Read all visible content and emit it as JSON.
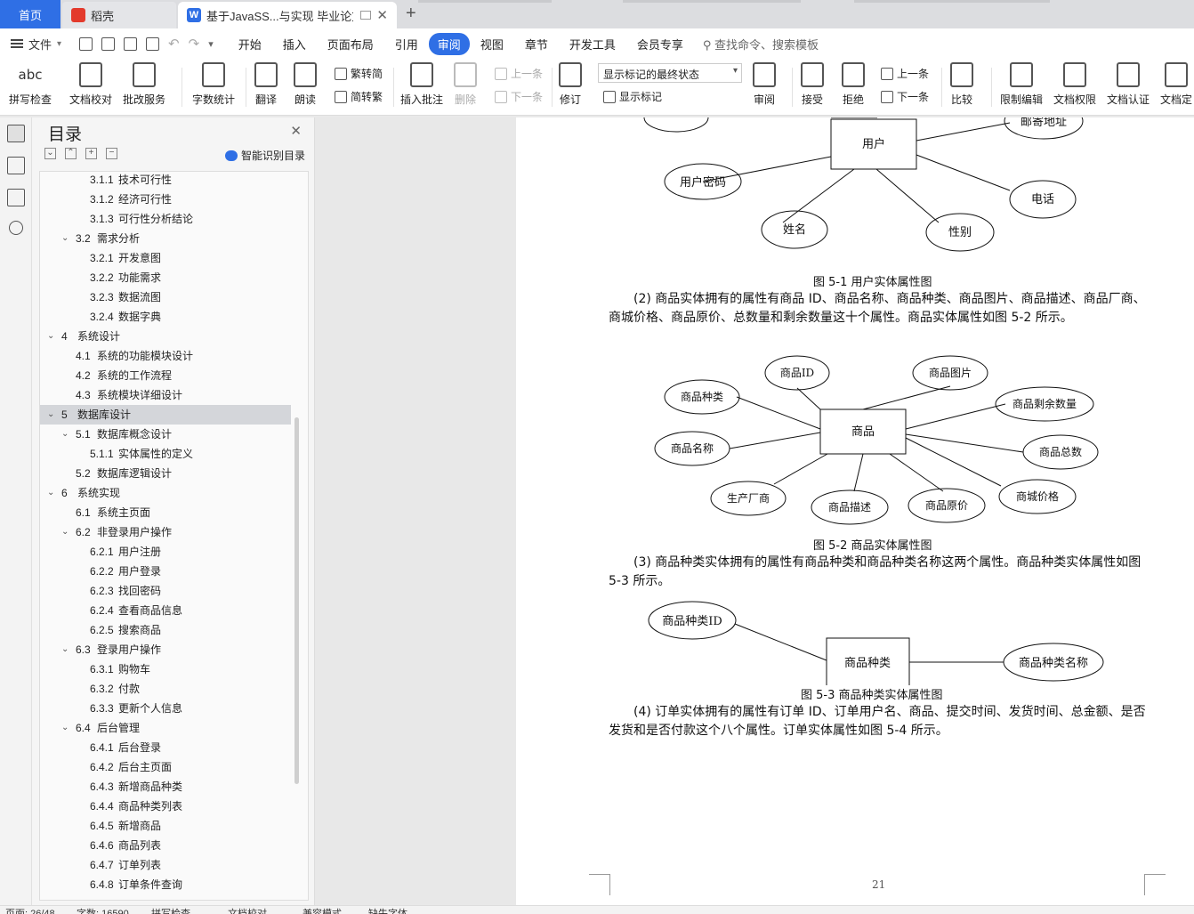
{
  "tabs": {
    "home": "首页",
    "shell": "稻壳",
    "doc": "基于JavaSS...与实现 毕业论文",
    "doc_icon": "W"
  },
  "menu": {
    "file": "文件",
    "items": [
      "开始",
      "插入",
      "页面布局",
      "引用",
      "审阅",
      "视图",
      "章节",
      "开发工具",
      "会员专享"
    ],
    "active": "审阅",
    "search": "查找命令、搜索模板"
  },
  "ribbon": {
    "spell": "拼写检查",
    "spell_icon": "abc",
    "doccheck": "文档校对",
    "batch": "批改服务",
    "wordcount": "字数统计",
    "translate": "翻译",
    "read": "朗读",
    "trad": "繁转简",
    "simp": "简转繁",
    "insert_comment": "插入批注",
    "delete": "删除",
    "prev": "上一条",
    "next": "下一条",
    "track": "修订",
    "markup_state": "显示标记的最终状态",
    "show_markup": "显示标记",
    "review": "审阅",
    "accept": "接受",
    "reject": "拒绝",
    "prev2": "上一条",
    "next2": "下一条",
    "compare": "比较",
    "restrict": "限制编辑",
    "perm": "文档权限",
    "cert": "文档认证",
    "finalize": "文档定"
  },
  "toc": {
    "title": "目录",
    "smart": "智能识别目录",
    "items": [
      {
        "num": "3.1.1",
        "text": "技术可行性",
        "level": 3
      },
      {
        "num": "3.1.2",
        "text": "经济可行性",
        "level": 3
      },
      {
        "num": "3.1.3",
        "text": "可行性分析结论",
        "level": 3
      },
      {
        "num": "3.2",
        "text": "需求分析",
        "level": 2,
        "caret": true
      },
      {
        "num": "3.2.1",
        "text": "开发意图",
        "level": 3
      },
      {
        "num": "3.2.2",
        "text": "功能需求",
        "level": 3
      },
      {
        "num": "3.2.3",
        "text": "数据流图",
        "level": 3
      },
      {
        "num": "3.2.4",
        "text": "数据字典",
        "level": 3
      },
      {
        "num": "4",
        "text": "系统设计",
        "level": 1,
        "caret": true
      },
      {
        "num": "4.1",
        "text": "系统的功能模块设计",
        "level": 2
      },
      {
        "num": "4.2",
        "text": "系统的工作流程",
        "level": 2
      },
      {
        "num": "4.3",
        "text": "系统模块详细设计",
        "level": 2
      },
      {
        "num": "5",
        "text": "数据库设计",
        "level": 1,
        "caret": true,
        "selected": true
      },
      {
        "num": "5.1",
        "text": "数据库概念设计",
        "level": 2,
        "caret": true
      },
      {
        "num": "5.1.1",
        "text": "实体属性的定义",
        "level": 3
      },
      {
        "num": "5.2",
        "text": "数据库逻辑设计",
        "level": 2
      },
      {
        "num": "6",
        "text": "系统实现",
        "level": 1,
        "caret": true
      },
      {
        "num": "6.1",
        "text": "系统主页面",
        "level": 2
      },
      {
        "num": "6.2",
        "text": "非登录用户操作",
        "level": 2,
        "caret": true
      },
      {
        "num": "6.2.1",
        "text": "用户注册",
        "level": 3
      },
      {
        "num": "6.2.2",
        "text": "用户登录",
        "level": 3
      },
      {
        "num": "6.2.3",
        "text": "找回密码",
        "level": 3
      },
      {
        "num": "6.2.4",
        "text": "查看商品信息",
        "level": 3
      },
      {
        "num": "6.2.5",
        "text": "搜索商品",
        "level": 3
      },
      {
        "num": "6.3",
        "text": "登录用户操作",
        "level": 2,
        "caret": true
      },
      {
        "num": "6.3.1",
        "text": "购物车",
        "level": 3
      },
      {
        "num": "6.3.2",
        "text": "付款",
        "level": 3
      },
      {
        "num": "6.3.3",
        "text": "更新个人信息",
        "level": 3
      },
      {
        "num": "6.4",
        "text": "后台管理",
        "level": 2,
        "caret": true
      },
      {
        "num": "6.4.1",
        "text": "后台登录",
        "level": 3
      },
      {
        "num": "6.4.2",
        "text": "后台主页面",
        "level": 3
      },
      {
        "num": "6.4.3",
        "text": "新增商品种类",
        "level": 3
      },
      {
        "num": "6.4.4",
        "text": "商品种类列表",
        "level": 3
      },
      {
        "num": "6.4.5",
        "text": "新增商品",
        "level": 3
      },
      {
        "num": "6.4.6",
        "text": "商品列表",
        "level": 3
      },
      {
        "num": "6.4.7",
        "text": "订单列表",
        "level": 3
      },
      {
        "num": "6.4.8",
        "text": "订单条件查询",
        "level": 3
      }
    ]
  },
  "doc": {
    "fig1": {
      "entity": "用户",
      "attrs": [
        "用户密码",
        "姓名",
        "性别",
        "电话",
        "邮寄地址"
      ],
      "caption": "图 5-1 用户实体属性图"
    },
    "para2": "(2) 商品实体拥有的属性有商品 ID、商品名称、商品种类、商品图片、商品描述、商品厂商、商城价格、商品原价、总数量和剩余数量这十个属性。商品实体属性如图 5-2 所示。",
    "fig2": {
      "entity": "商品",
      "attrs": [
        "商品ID",
        "商品图片",
        "商品种类",
        "商品剩余数量",
        "商品名称",
        "商品总数",
        "生产厂商",
        "商品描述",
        "商品原价",
        "商城价格"
      ],
      "caption": "图 5-2 商品实体属性图"
    },
    "para3": "(3) 商品种类实体拥有的属性有商品种类和商品种类名称这两个属性。商品种类实体属性如图 5-3 所示。",
    "fig3": {
      "entity": "商品种类",
      "attrs": [
        "商品种类ID",
        "商品种类名称"
      ],
      "caption": "图 5-3 商品种类实体属性图"
    },
    "para4": "(4) 订单实体拥有的属性有订单 ID、订单用户名、商品、提交时间、发货时间、总金额、是否发货和是否付款这个八个属性。订单实体属性如图 5-4 所示。",
    "page_number": "21"
  },
  "status": {
    "page": "页面: 26/48",
    "words": "字数: 16590",
    "spell": "拼写检查",
    "check": "文档校对",
    "compat": "兼容模式",
    "missing_font": "缺失字体"
  },
  "colors": {
    "accent": "#2f6fe5",
    "toc_selected": "#d4d6da"
  }
}
